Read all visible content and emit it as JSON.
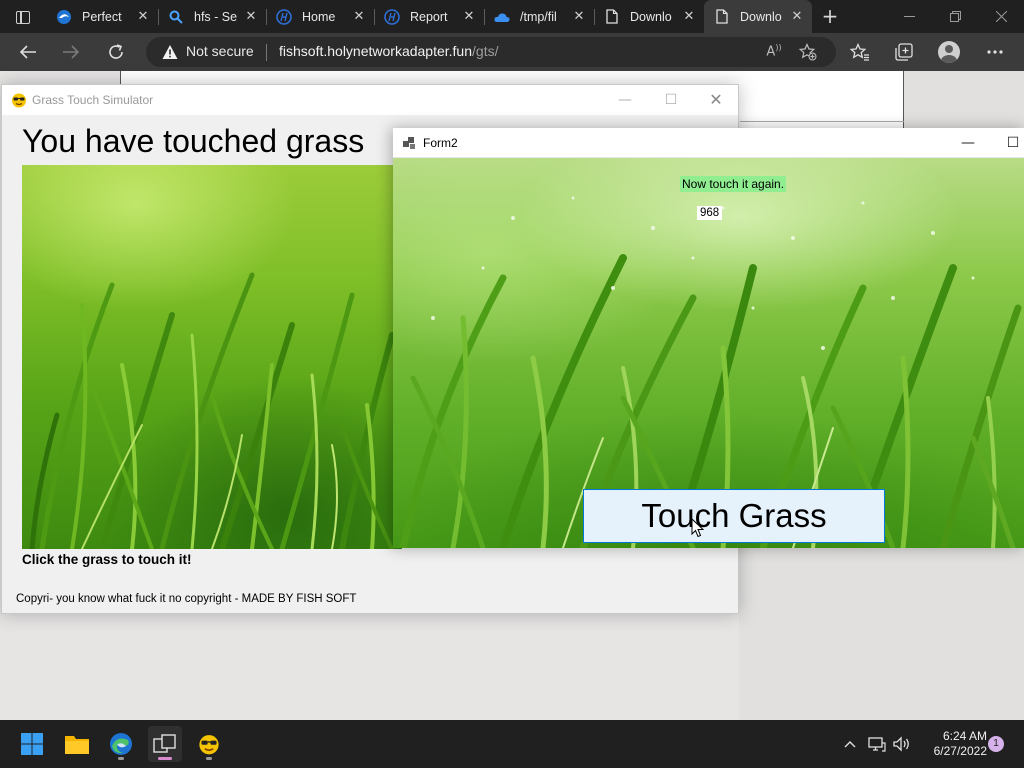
{
  "browser": {
    "tabs": [
      {
        "title": "Perfect",
        "icon": "edge-icon"
      },
      {
        "title": "hfs - Se",
        "icon": "search-icon"
      },
      {
        "title": "Home",
        "icon": "hp-logo-icon"
      },
      {
        "title": "Report",
        "icon": "hp-logo-icon"
      },
      {
        "title": "/tmp/fil",
        "icon": "onedrive-icon"
      },
      {
        "title": "Downlo",
        "icon": "page-icon"
      },
      {
        "title": "Downlo",
        "icon": "page-icon",
        "active": true
      }
    ],
    "address": {
      "security_label": "Not secure",
      "host": "fishsoft.holynetworkadapter.fun",
      "path": "/gts/"
    }
  },
  "gts_window": {
    "title": "Grass Touch Simulator",
    "heading": "You have touched grass",
    "instruction": "Click the grass to touch it!",
    "copyright": "Copyri- you know what fuck it no copyright - MADE BY FISH SOFT"
  },
  "form2": {
    "title": "Form2",
    "message": "Now touch it again.",
    "count": "968",
    "button_label": "Touch Grass"
  },
  "taskbar": {
    "apps": [
      "start-icon",
      "file-explorer-icon",
      "edge-icon",
      "task-view-icon",
      "grass-app-icon"
    ],
    "time": "6:24 AM",
    "date": "6/27/2022",
    "notification_count": "1"
  },
  "colors": {
    "accent_button_border": "#0078d7",
    "accent_button_bg": "#e5f1fb",
    "message_bg": "#90ee90",
    "dark_chrome": "#202020"
  }
}
